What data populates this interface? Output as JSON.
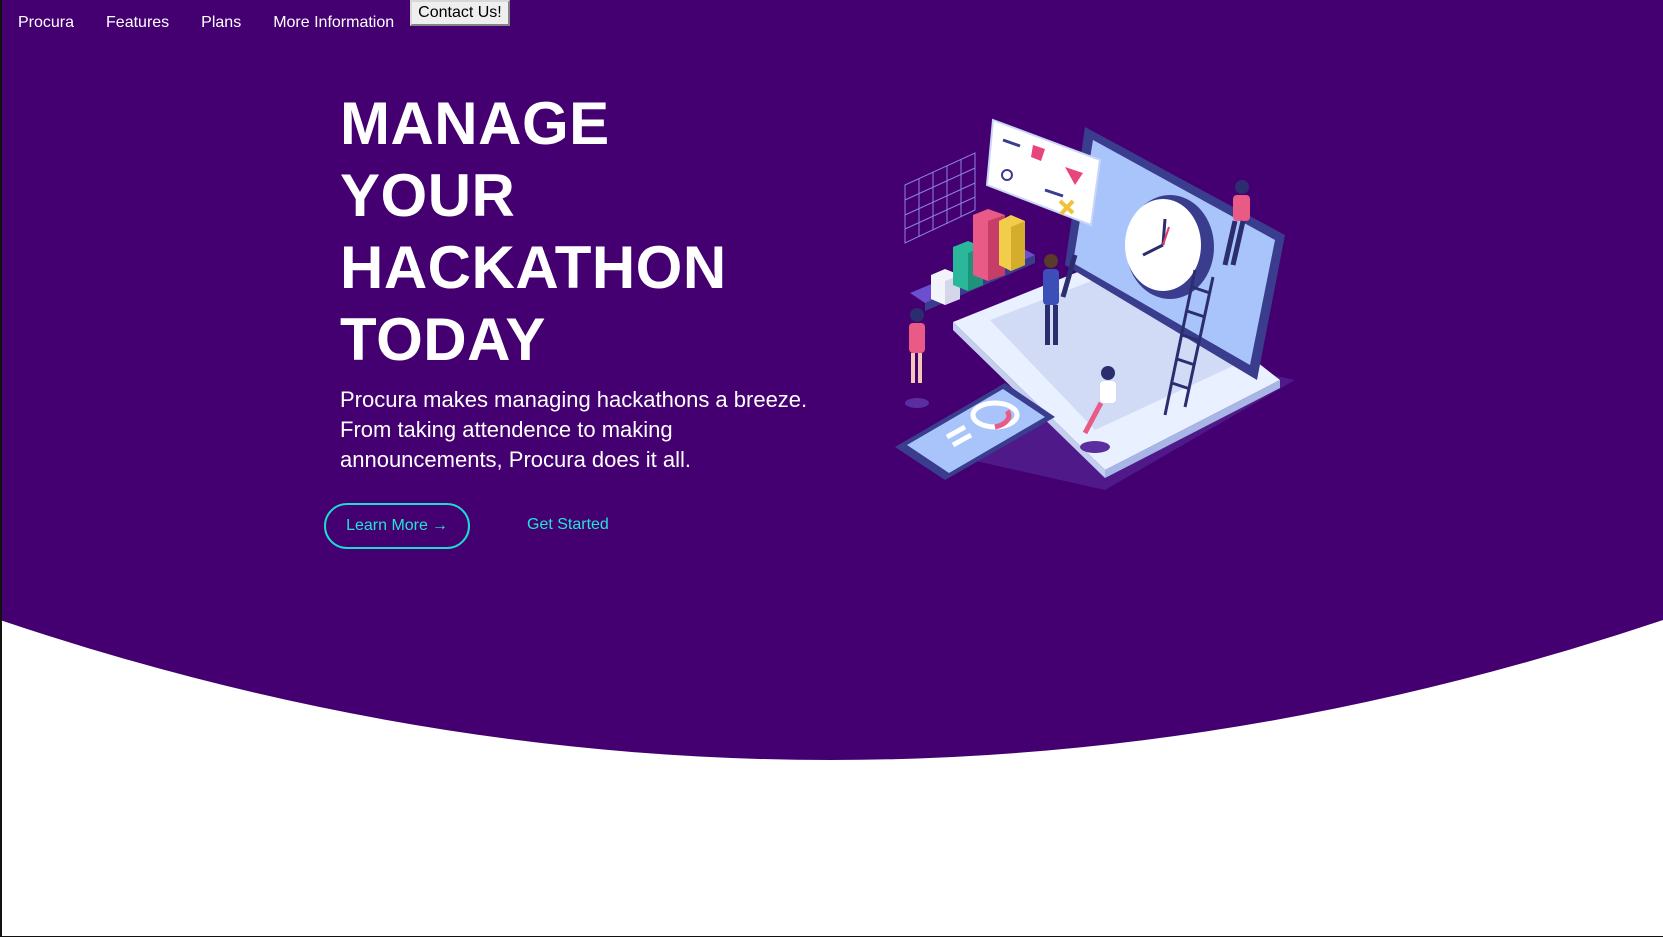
{
  "nav": {
    "brand": "Procura",
    "links": [
      "Features",
      "Plans",
      "More Information"
    ],
    "contact_label": "Contact Us!"
  },
  "hero": {
    "title_lines": [
      "MANAGE",
      "YOUR",
      "HACKATHON",
      "TODAY"
    ],
    "description": "Procura makes managing hackathons a breeze. From taking attendence to making announcements, Procura does it all.",
    "learn_more_label": "Learn More",
    "learn_more_arrow": "→",
    "get_started_label": "Get Started"
  },
  "colors": {
    "hero_background": "#440070",
    "accent_teal": "#23e3d6",
    "page_background": "#ffffff"
  },
  "illustration": {
    "icons": [
      "laptop-icon",
      "clock-icon",
      "bar-chart-icon",
      "calendar-icon",
      "phone-icon",
      "ladder-icon",
      "person-icon"
    ]
  }
}
